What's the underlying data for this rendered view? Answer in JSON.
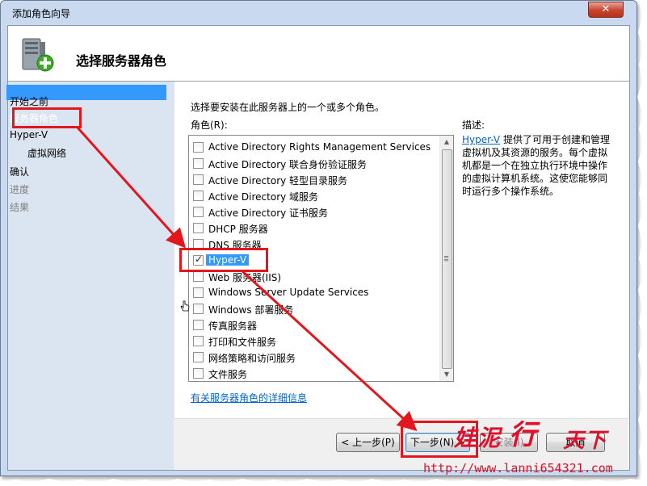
{
  "window": {
    "title": "添加角色向导",
    "close_glyph": "✕"
  },
  "header": {
    "title": "选择服务器角色",
    "icon": "server-add-icon"
  },
  "nav": {
    "items": [
      {
        "label": "开始之前",
        "state": "normal"
      },
      {
        "label": "服务器角色",
        "state": "selected"
      },
      {
        "label": "Hyper-V",
        "state": "normal"
      },
      {
        "label": "虚拟网络",
        "state": "sub"
      },
      {
        "label": "确认",
        "state": "normal"
      },
      {
        "label": "进度",
        "state": "disabled"
      },
      {
        "label": "结果",
        "state": "disabled"
      }
    ]
  },
  "main": {
    "instruction": "选择要安装在此服务器上的一个或多个角色。",
    "roles_label": "角色(R):",
    "roles": [
      {
        "label": "Active Directory Rights Management Services",
        "checked": false
      },
      {
        "label": "Active Directory 联合身份验证服务",
        "checked": false
      },
      {
        "label": "Active Directory 轻型目录服务",
        "checked": false
      },
      {
        "label": "Active Directory 域服务",
        "checked": false
      },
      {
        "label": "Active Directory 证书服务",
        "checked": false
      },
      {
        "label": "DHCP 服务器",
        "checked": false
      },
      {
        "label": "DNS 服务器",
        "checked": false
      },
      {
        "label": "Hyper-V",
        "checked": true,
        "selected": true
      },
      {
        "label": "Web 服务器(IIS)",
        "checked": false
      },
      {
        "label": "Windows Server Update Services",
        "checked": false
      },
      {
        "label": "Windows 部署服务",
        "checked": false
      },
      {
        "label": "传真服务器",
        "checked": false
      },
      {
        "label": "打印和文件服务",
        "checked": false
      },
      {
        "label": "网络策略和访问服务",
        "checked": false
      },
      {
        "label": "文件服务",
        "checked": false
      }
    ],
    "more_info_link": "有关服务器角色的详细信息",
    "description": {
      "label": "描述:",
      "link": "Hyper-V",
      "text": " 提供了可用于创建和管理虚拟机及其资源的服务。每个虚拟机都是一个在独立执行环境中操作的虚拟计算机系统。这使您能够同时运行多个操作系统。"
    }
  },
  "buttons": {
    "prev": "< 上一步(P)",
    "next": "下一步(N) >",
    "install": "安装(I)",
    "cancel": "取消"
  },
  "watermark": {
    "text": "娃泥行天下",
    "url": "http://www.lanni654321.com"
  },
  "colors": {
    "selection": "#3399ff",
    "nav_bg": "#dbe5f1",
    "annotation": "#e3161b",
    "link": "#0066cc"
  }
}
